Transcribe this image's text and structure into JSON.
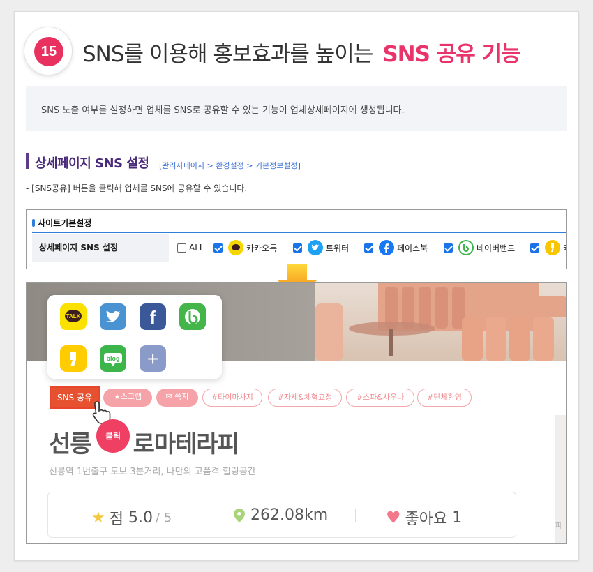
{
  "header": {
    "number": "15",
    "title": "SNS를 이용해 홍보효과를 높이는",
    "title_highlight": "SNS 공유 기능"
  },
  "description": "SNS 노출 여부를 설정하면 업체를 SNS로 공유할 수 있는 기능이 업체상세페이지에 생성됩니다.",
  "section": {
    "title": "상세페이지 SNS 설정",
    "breadcrumb": "[관리자페이지 > 환경설정 > 기본정보설정]",
    "note": "- [SNS공유] 버튼을 클릭해 업체를 SNS에 공유할 수 있습니다."
  },
  "settings": {
    "header": "사이트기본설정",
    "row_label": "상세페이지 SNS 설정",
    "options": [
      {
        "label": "ALL",
        "checked": false,
        "icon": "none"
      },
      {
        "label": "카카오톡",
        "checked": true,
        "icon": "kakaotalk-icon",
        "color": "#f7d500"
      },
      {
        "label": "트위터",
        "checked": true,
        "icon": "twitter-icon",
        "color": "#1da1f2"
      },
      {
        "label": "페이스북",
        "checked": true,
        "icon": "facebook-icon",
        "color": "#1877f2"
      },
      {
        "label": "네이버밴드",
        "checked": true,
        "icon": "naver-band-icon",
        "color": "#3cb54a"
      },
      {
        "label": "카",
        "checked": true,
        "icon": "kakaostory-icon",
        "color": "#f7c600"
      }
    ]
  },
  "preview": {
    "share_icons": [
      {
        "icon": "kakaotalk-icon",
        "text": "TALK",
        "color": "#fae100"
      },
      {
        "icon": "twitter-icon",
        "text": "",
        "color": "#4a93d2"
      },
      {
        "icon": "facebook-icon",
        "text": "f",
        "color": "#3b5998"
      },
      {
        "icon": "naver-band-icon",
        "text": "b",
        "color": "#43b549"
      },
      {
        "icon": "kakaostory-icon",
        "text": "",
        "color": "#ffcc00"
      },
      {
        "icon": "blog-icon",
        "text": "blog",
        "color": "#3cb54a"
      },
      {
        "icon": "plus-icon",
        "text": "+",
        "color": "#8b9bc9"
      }
    ],
    "sns_share_button": "SNS 공유",
    "scrap_button": "스크랩",
    "message_button": "쪽지",
    "hashtags": [
      "#타이마사지",
      "#자세&체형교정",
      "#스파&사우나",
      "#단체환영"
    ],
    "shop_name": "선릉 아로마테라피",
    "shop_name_left": "선릉",
    "shop_name_right": "로마테라피",
    "click_label": "클릭",
    "shop_desc": "선릉역 1번출구 도보 3분거리, 나만의 고품격 힐링공간",
    "rating_label": "점",
    "rating_value": "5.0",
    "rating_max": "/ 5",
    "distance": "262.08km",
    "likes_label": "좋아요",
    "likes_count": "1",
    "map_text": "파"
  },
  "colors": {
    "accent_pink": "#e9336b",
    "section_purple": "#4a2a7a",
    "link_blue": "#3d6fd6",
    "sns_button": "#e6522f"
  }
}
